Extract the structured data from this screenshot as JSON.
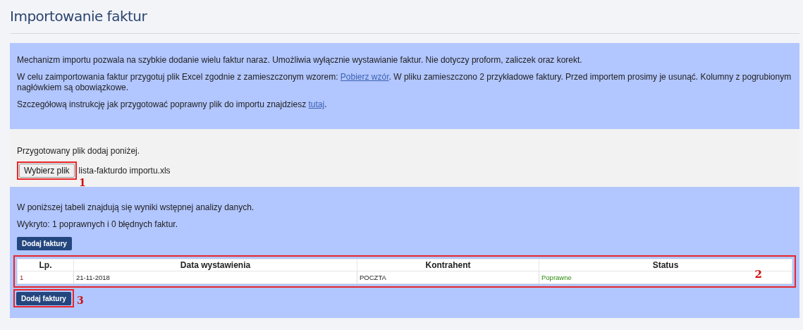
{
  "title": "Importowanie faktur",
  "info": {
    "paragraphs": [
      {
        "before": "Mechanizm importu pozwala na szybkie dodanie wielu faktur naraz. Umożliwia wyłącznie wystawianie faktur. Nie dotyczy proform, zaliczek oraz korekt."
      },
      {
        "before": "W celu zaimportowania faktur przygotuj plik Excel zgodnie z zamieszczonym wzorem: ",
        "link": "Pobierz wzór",
        "after": ". W pliku zamieszczono 2 przykładowe faktury. Przed importem prosimy je usunąć. Kolumny z pogrubionym nagłówkiem są obowiązkowe."
      },
      {
        "before": "Szczegółową instrukcję jak przygotować poprawny plik do importu znajdziesz ",
        "link": "tutaj",
        "after": "."
      }
    ]
  },
  "upload": {
    "label": "Przygotowany plik dodaj poniżej.",
    "button": "Wybierz plik",
    "filename": "lista-fakturdo importu.xls",
    "callout": "1"
  },
  "results": {
    "intro": "W poniższej tabeli znajdują się wyniki wstępnej analizy danych.",
    "summary": "Wykryto: 1 poprawnych i 0 błędnych faktur.",
    "top_button": "Dodaj faktury",
    "table": {
      "callout": "2",
      "columns": [
        "Lp.",
        "Data wystawienia",
        "Kontrahent",
        "Status"
      ],
      "rows": [
        {
          "cells": [
            "1",
            "21-11-2018",
            "POCZTA",
            "Poprawne"
          ],
          "valid": true
        }
      ]
    },
    "bottom_button": {
      "label": "Dodaj faktury",
      "callout": "3"
    }
  }
}
